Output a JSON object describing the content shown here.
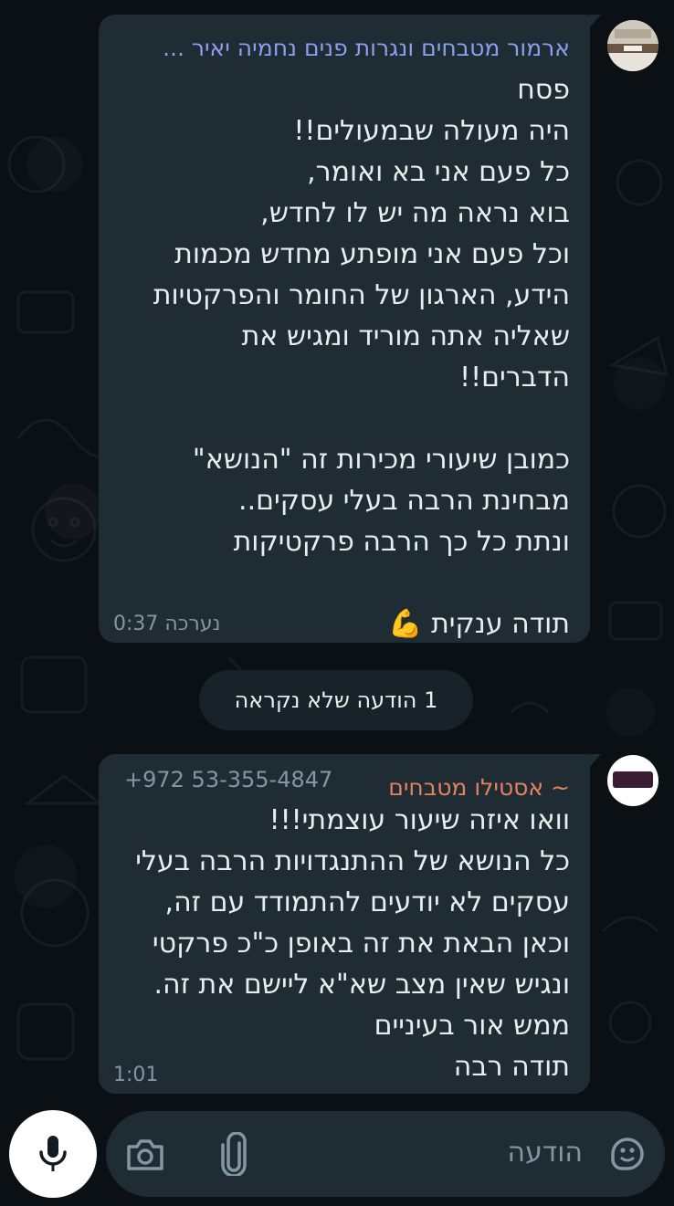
{
  "messages": [
    {
      "sender": "ארמור מטבחים ונגרות פנים נחמיה יאיר ...",
      "text": "פסח\nהיה מעולה שבמעולים!!\nכל פעם אני בא ואומר,\nבוא נראה מה יש לו לחדש,\nוכל פעם אני מופתע מחדש מכמות\nהידע, הארגון של החומר והפרקטיות\nשאליה אתה מוריד ומגיש את\nהדברים!!\n\nכמובן שיעורי מכירות זה \"הנושא\"\nמבחינת הרבה בעלי עסקים..\nונתת כל כך הרבה פרקטיקות\n\nתודה ענקית 💪",
      "meta": "נערכה 0:37"
    },
    {
      "sender": "~ אסטילו מטבחים",
      "phone": "+972 53-355-4847",
      "text": "וואו איזה שיעור עוצמתי!!!\nכל הנושא של ההתנגדויות הרבה בעלי\nעסקים לא יודעים להתמודד עם זה,\nוכאן הבאת את זה באופן כ\"כ פרקטי\nונגיש שאין מצב שא\"א ליישם את זה.\nממש אור בעיניים\nתודה רבה",
      "meta": "1:01"
    }
  ],
  "unread_divider": "1 הודעה שלא נקראה",
  "composer": {
    "placeholder": "הודעה"
  },
  "colors": {
    "background": "#0b1014",
    "bubble": "#1f2c33",
    "sender1": "#8b9fef",
    "sender2": "#e3825e",
    "meta": "#8696a0"
  }
}
